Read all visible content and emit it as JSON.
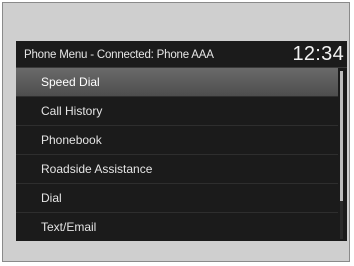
{
  "header": {
    "title": "Phone Menu - Connected: Phone AAA",
    "clock": "12:34"
  },
  "menu": {
    "items": [
      {
        "label": "Speed Dial",
        "selected": true
      },
      {
        "label": "Call History",
        "selected": false
      },
      {
        "label": "Phonebook",
        "selected": false
      },
      {
        "label": "Roadside Assistance",
        "selected": false
      },
      {
        "label": "Dial",
        "selected": false
      },
      {
        "label": "Text/Email",
        "selected": false
      }
    ]
  },
  "colors": {
    "screen_background": "#1b1b1b",
    "selected_highlight": "#5c5c5c",
    "text": "#e4e4e4"
  }
}
